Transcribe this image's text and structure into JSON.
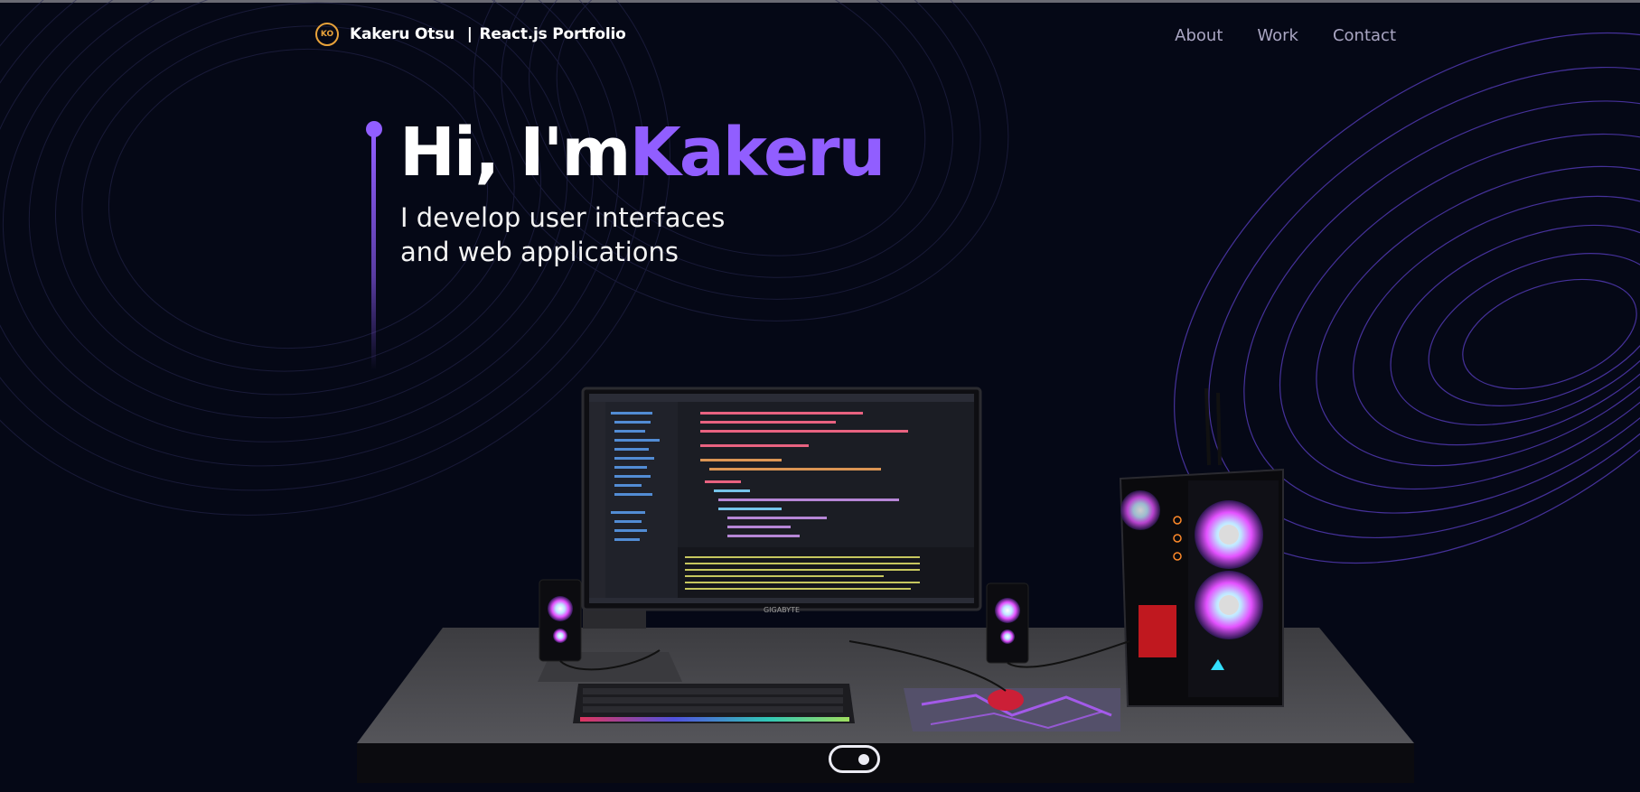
{
  "nav": {
    "logo_text": "KO",
    "brand_name": "Kakeru Otsu",
    "brand_separator": "|",
    "brand_suffix": "React.js Portfolio",
    "links": [
      "About",
      "Work",
      "Contact"
    ]
  },
  "hero": {
    "greeting": "Hi, I'm",
    "name": "Kakeru",
    "subtitle_line1": "I develop user interfaces",
    "subtitle_line2": "and web applications"
  },
  "scene": {
    "monitor_brand": "GIGABYTE"
  },
  "colors": {
    "background": "#050816",
    "accent": "#915eff",
    "nav_link": "#aaa6c3",
    "logo": "#e8a23a"
  }
}
